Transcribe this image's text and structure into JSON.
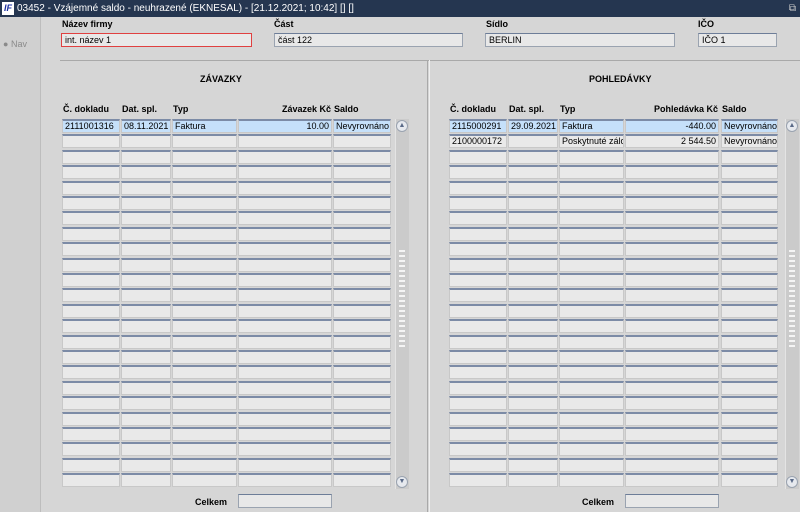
{
  "window": {
    "title": "03452 - Vzájemné saldo - neuhrazené (EKNESAL) - [21.12.2021; 10:42] [] []",
    "logo": "IF"
  },
  "sidebar": {
    "nav_label": "Nav"
  },
  "header": {
    "firm_label": "Název firmy",
    "firm_value": "int. název 1",
    "part_label": "Část",
    "part_value": "část 122",
    "seat_label": "Sídlo",
    "seat_value": "BERLIN",
    "ico_label": "IČO",
    "ico_value": "IČO 1"
  },
  "left": {
    "title": "ZÁVAZKY",
    "columns": [
      "Č. dokladu",
      "Dat. spl.",
      "Typ",
      "Závazek Kč",
      "Saldo"
    ],
    "rows": [
      [
        "2111001316",
        "08.11.2021",
        "Faktura",
        "10.00",
        "Nevyrovnáno"
      ]
    ],
    "total_label": "Celkem",
    "total_value": ""
  },
  "right": {
    "title": "POHLEDÁVKY",
    "columns": [
      "Č. dokladu",
      "Dat. spl.",
      "Typ",
      "Pohledávka Kč",
      "Saldo"
    ],
    "rows": [
      [
        "2115000291",
        "29.09.2021",
        "Faktura",
        "-440.00",
        "Nevyrovnáno"
      ],
      [
        "2100000172",
        "",
        "Poskytnuté zálo",
        "2 544.50",
        "Nevyrovnáno"
      ]
    ],
    "total_label": "Celkem",
    "total_value": ""
  }
}
